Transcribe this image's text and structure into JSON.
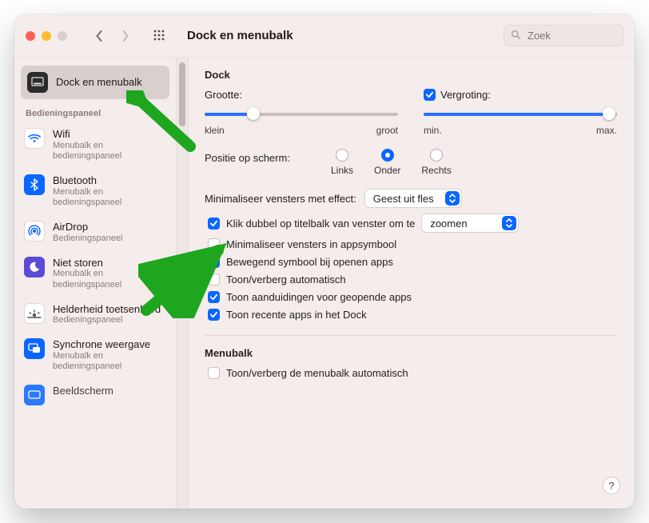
{
  "titlebar": {
    "title": "Dock en menubalk",
    "search_placeholder": "Zoek"
  },
  "sidebar": {
    "selected": {
      "label": "Dock en menubalk"
    },
    "group_header": "Bedieningspaneel",
    "items": [
      {
        "title": "Wifi",
        "sub": "Menubalk en bedieningspaneel"
      },
      {
        "title": "Bluetooth",
        "sub": "Menubalk en bedieningspaneel"
      },
      {
        "title": "AirDrop",
        "sub": "Bedieningspaneel"
      },
      {
        "title": "Niet storen",
        "sub": "Menubalk en bedieningspaneel"
      },
      {
        "title": "Helderheid toetsenbord",
        "sub": "Bedieningspaneel"
      },
      {
        "title": "Synchrone weergave",
        "sub": "Menubalk en bedieningspaneel"
      },
      {
        "title": "Beeldscherm",
        "sub": ""
      }
    ]
  },
  "dock": {
    "section_title": "Dock",
    "size_label": "Grootte:",
    "size_min": "klein",
    "size_max": "groot",
    "mag_label": "Vergroting:",
    "mag_min": "min.",
    "mag_max": "max.",
    "position_label": "Positie op scherm:",
    "pos_left": "Links",
    "pos_center": "Onder",
    "pos_right": "Rechts",
    "minimize_label": "Minimaliseer vensters met effect:",
    "minimize_value": "Geest uit fles",
    "dblclick_label": "Klik dubbel op titelbalk van venster om te",
    "dblclick_value": "zoomen",
    "min_into_icon": "Minimaliseer vensters in appsymbool",
    "animate_open": "Bewegend symbool bij openen apps",
    "autohide": "Toon/verberg automatisch",
    "indicators": "Toon aanduidingen voor geopende apps",
    "recent_apps": "Toon recente apps in het Dock"
  },
  "menubar": {
    "section_title": "Menubalk",
    "autohide": "Toon/verberg de menubalk automatisch"
  }
}
